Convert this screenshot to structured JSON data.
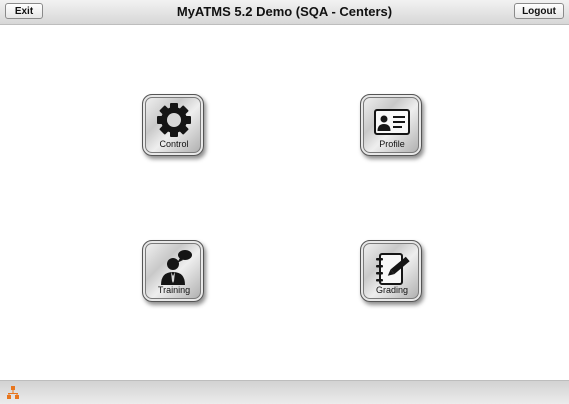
{
  "header": {
    "title": "MyATMS 5.2 Demo (SQA - Centers)",
    "exit_label": "Exit",
    "logout_label": "Logout"
  },
  "tiles": [
    {
      "label": "Control",
      "icon": "gear-icon"
    },
    {
      "label": "Profile",
      "icon": "id-card-icon"
    },
    {
      "label": "Training",
      "icon": "person-speech-icon"
    },
    {
      "label": "Grading",
      "icon": "notebook-pen-icon"
    }
  ],
  "footer": {
    "icon": "network-status-icon",
    "icon_color": "#e8761e"
  },
  "colors": {
    "accent": "#e8761e",
    "tile_border": "#555555"
  }
}
